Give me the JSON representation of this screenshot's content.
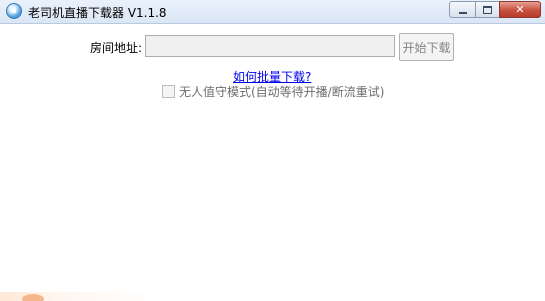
{
  "window": {
    "title": "老司机直播下载器 V1.1.8",
    "controls": {
      "minimize": "minimize",
      "maximize": "maximize",
      "close": "✕"
    }
  },
  "form": {
    "room_label": "房间地址:",
    "room_value": "",
    "start_button": "开始下载",
    "batch_link": "如何批量下载?",
    "unattended_label": "无人值守模式(自动等待开播/断流重试)",
    "unattended_checked": false
  },
  "icons": [
    "app-icon",
    "minimize-icon",
    "maximize-icon",
    "close-icon"
  ]
}
